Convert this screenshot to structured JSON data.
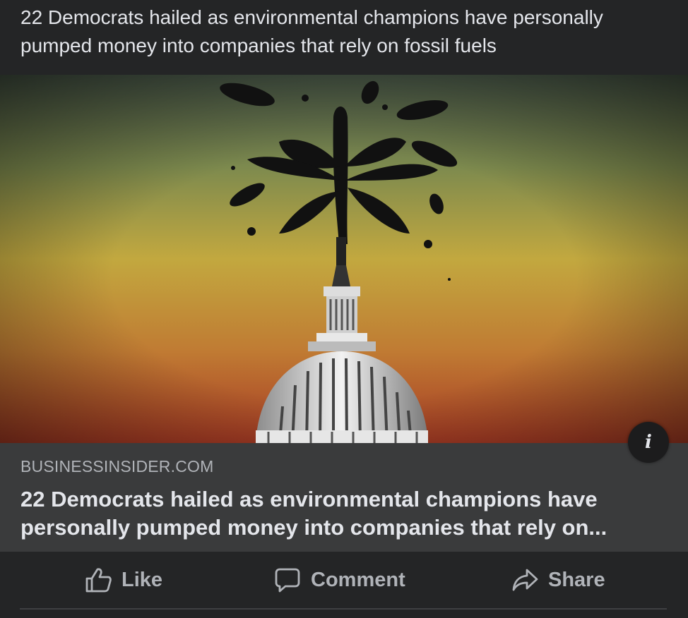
{
  "post": {
    "text": "22 Democrats hailed as environmental champions have personally pumped money into companies that rely on fossil fuels"
  },
  "link_preview": {
    "image_alt": "Capitol dome with oil gushing",
    "domain": "BUSINESSINSIDER.COM",
    "headline": "22 Democrats hailed as environmental champions have personally pumped money into companies that rely on...",
    "info_icon": "info-icon"
  },
  "actions": {
    "like": {
      "label": "Like",
      "icon": "thumbs-up-icon"
    },
    "comment": {
      "label": "Comment",
      "icon": "comment-icon"
    },
    "share": {
      "label": "Share",
      "icon": "share-arrow-icon"
    }
  },
  "colors": {
    "background": "#242526",
    "card": "#3a3b3c",
    "text_primary": "#e4e6eb",
    "text_secondary": "#b0b3b8"
  }
}
